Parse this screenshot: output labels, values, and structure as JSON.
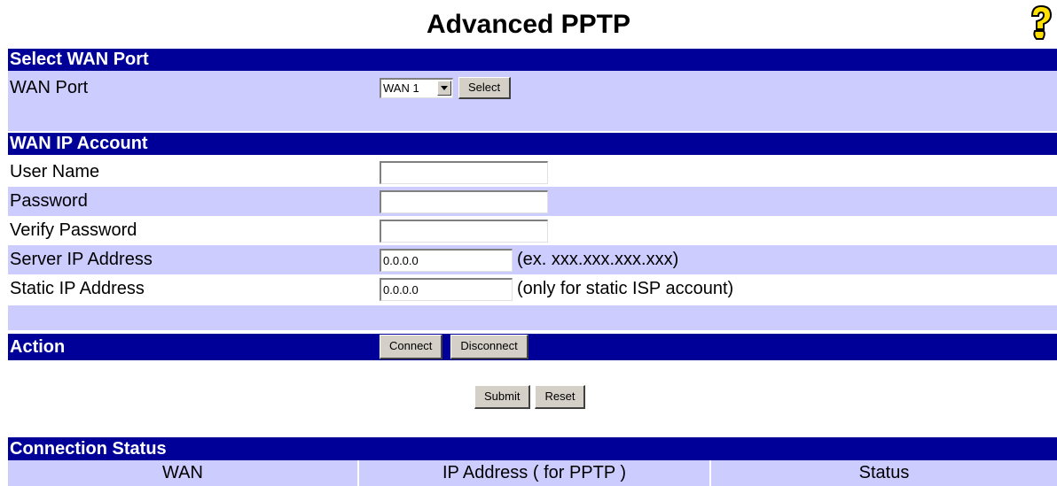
{
  "page": {
    "title": "Advanced PPTP"
  },
  "colors": {
    "header": "#000099",
    "row_alt": "#ccccff"
  },
  "select_wan": {
    "header": "Select WAN Port",
    "label": "WAN Port",
    "selected": "WAN 1",
    "button": "Select"
  },
  "account": {
    "header": "WAN IP Account",
    "username_label": "User Name",
    "username_value": "",
    "password_label": "Password",
    "password_value": "",
    "verify_label": "Verify Password",
    "verify_value": "",
    "server_ip_label": "Server IP Address",
    "server_ip_value": "0.0.0.0",
    "server_ip_hint": "(ex. xxx.xxx.xxx.xxx)",
    "static_ip_label": "Static IP Address",
    "static_ip_value": "0.0.0.0",
    "static_ip_hint": "(only for static ISP account)"
  },
  "action": {
    "header": "Action",
    "connect": "Connect",
    "disconnect": "Disconnect"
  },
  "form": {
    "submit": "Submit",
    "reset": "Reset"
  },
  "status": {
    "header": "Connection Status",
    "columns": [
      "WAN",
      "IP Address ( for PPTP )",
      "Status"
    ]
  }
}
